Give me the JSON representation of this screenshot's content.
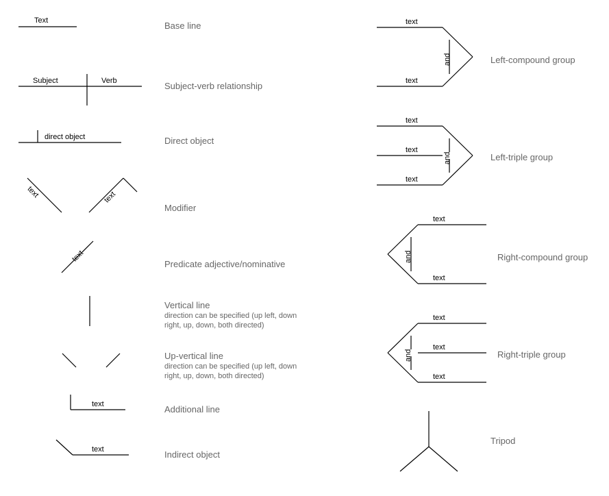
{
  "left": {
    "baseline": {
      "label": "Base line",
      "text": "Text"
    },
    "subject_verb": {
      "label": "Subject-verb relationship",
      "subject": "Subject",
      "verb": "Verb"
    },
    "direct_object": {
      "label": "Direct object",
      "text": "direct object"
    },
    "modifier": {
      "label": "Modifier",
      "text1": "text",
      "text2": "text"
    },
    "pred_adj": {
      "label": "Predicate adjective/nominative",
      "text": "text"
    },
    "vline": {
      "label": "Vertical line",
      "desc": "direction can be specified (up left, down right, up, down, both directed)"
    },
    "upvline": {
      "label": "Up-vertical line",
      "desc": "direction can be specified (up left, down right, up, down, both directed)"
    },
    "add_line": {
      "label": "Additional line",
      "text": "text"
    },
    "indirect": {
      "label": "Indirect object",
      "text": "text"
    }
  },
  "right": {
    "left_compound": {
      "label": "Left-compound group",
      "conj": "and",
      "text1": "text",
      "text2": "text"
    },
    "left_triple": {
      "label": "Left-triple group",
      "conj": "and",
      "text1": "text",
      "text2": "text",
      "text3": "text"
    },
    "right_compound": {
      "label": "Right-compound group",
      "conj": "and",
      "text1": "text",
      "text2": "text"
    },
    "right_triple": {
      "label": "Right-triple group",
      "conj": "and",
      "text1": "text",
      "text2": "text",
      "text3": "text"
    },
    "tripod": {
      "label": "Tripod"
    }
  }
}
